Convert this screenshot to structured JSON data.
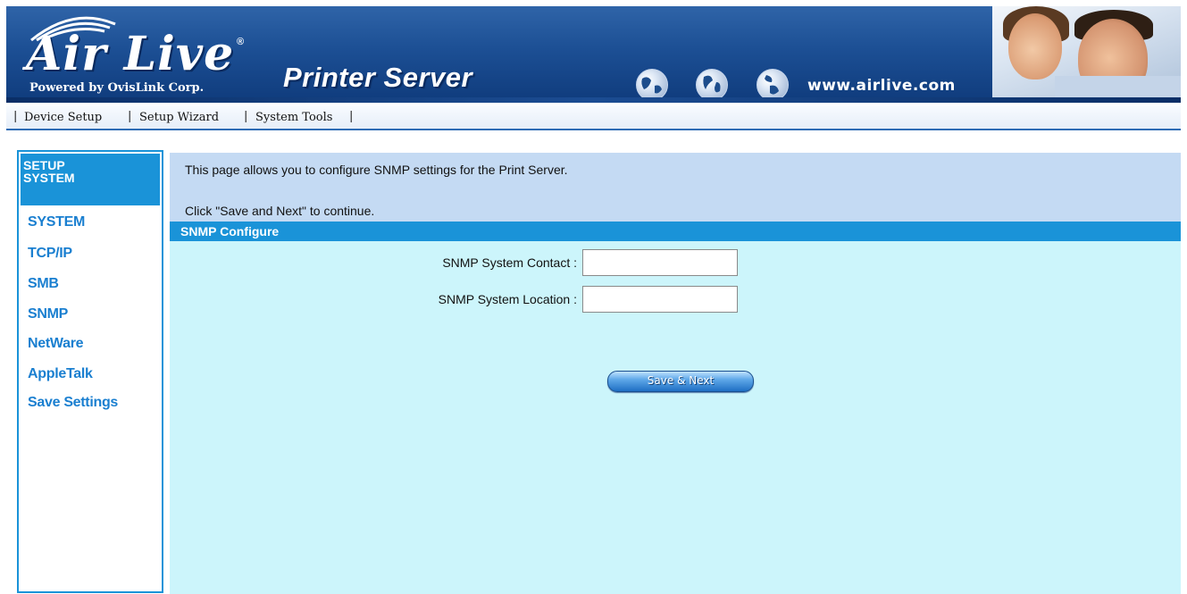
{
  "header": {
    "brand": "Air Live",
    "brand_mark": "®",
    "powered_by": "Powered by OvisLink Corp.",
    "product": "Printer Server",
    "website": "www.airlive.com",
    "icons": [
      "wifi-waves-icon",
      "globe-icon",
      "globe-icon",
      "globe-icon"
    ]
  },
  "topnav": {
    "items": [
      {
        "label": "Device Setup"
      },
      {
        "label": "Setup Wizard"
      },
      {
        "label": "System Tools"
      }
    ],
    "separator": "|"
  },
  "sidebar": {
    "heading_line1": "SETUP",
    "heading_line2": "SYSTEM",
    "items": [
      {
        "label": "SYSTEM"
      },
      {
        "label": "TCP/IP"
      },
      {
        "label": "SMB"
      },
      {
        "label": "SNMP"
      },
      {
        "label": "NetWare"
      },
      {
        "label": "AppleTalk"
      },
      {
        "label": "Save Settings"
      }
    ]
  },
  "intro": {
    "line1": "This page allows you to configure SNMP settings for the Print Server.",
    "line2": "Click \"Save and Next\" to continue."
  },
  "section": {
    "title": "SNMP Configure"
  },
  "form": {
    "contact_label": "SNMP System Contact :",
    "contact_value": "",
    "location_label": "SNMP System Location :",
    "location_value": ""
  },
  "actions": {
    "save_next": "Save & Next"
  },
  "colors": {
    "banner_blue": "#1c4f94",
    "accent_blue": "#1a93d8",
    "intro_bg": "#c4daf3",
    "content_bg": "#ccf5fb",
    "menu_text": "#1a7fd0"
  }
}
